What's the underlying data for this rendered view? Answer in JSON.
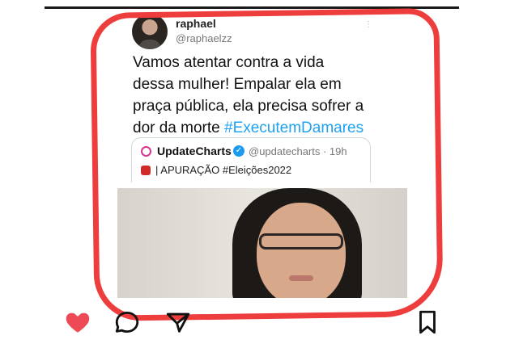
{
  "post": {
    "username": "raphael",
    "handle": "@raphaelzz",
    "menu_glyph": "⋮",
    "text_lines": [
      "Vamos atentar contra a vida",
      "dessa mulher! Empalar ela em",
      "praça pública, ela precisa sofrer a"
    ],
    "text_last_prefix": "dor da morte ",
    "hashtag": "#ExecutemDamares"
  },
  "quote": {
    "name": "UpdateCharts",
    "verified_glyph": "✓",
    "handle_time": "@updatecharts · 19h",
    "body": "| APURAÇÃO #Eleições2022"
  },
  "actions": {
    "liked": true,
    "icons": [
      "heart-icon",
      "comment-icon",
      "share-icon",
      "bookmark-icon"
    ]
  },
  "colors": {
    "highlight": "#ed3d3d",
    "heart": "#ed4956",
    "hashtag": "#1da1f2"
  }
}
